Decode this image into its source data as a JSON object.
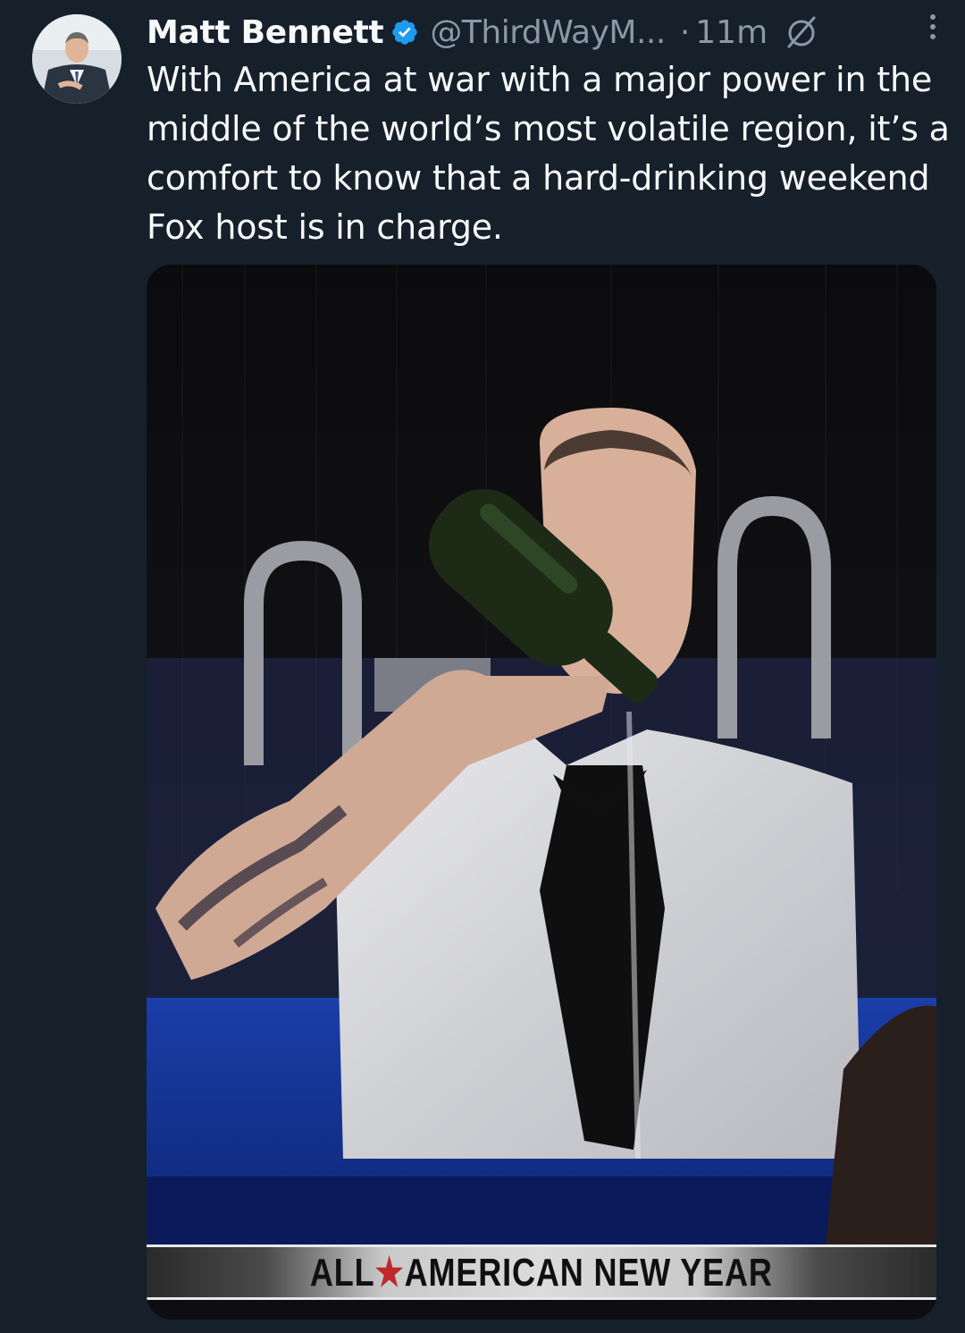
{
  "tweet": {
    "author_name": "Matt Bennett",
    "handle": "@ThirdWayM...",
    "separator": "·",
    "time": "11m",
    "text": "With America at war with a major power in the middle of the world’s most volatile region, it’s a comfort to know that a hard-drinking weekend Fox host is in charge.",
    "media": {
      "banner_left": "ALL",
      "banner_star": "★",
      "banner_right": "AMERICAN NEW YEAR"
    }
  },
  "icons": {
    "verified": "verified-badge-icon",
    "grok": "grok-icon",
    "more": "more-options-icon"
  },
  "colors": {
    "background": "#15202b",
    "text_primary": "#f7f9f9",
    "text_secondary": "#8b98a5",
    "verified_blue": "#1d9bf0"
  }
}
